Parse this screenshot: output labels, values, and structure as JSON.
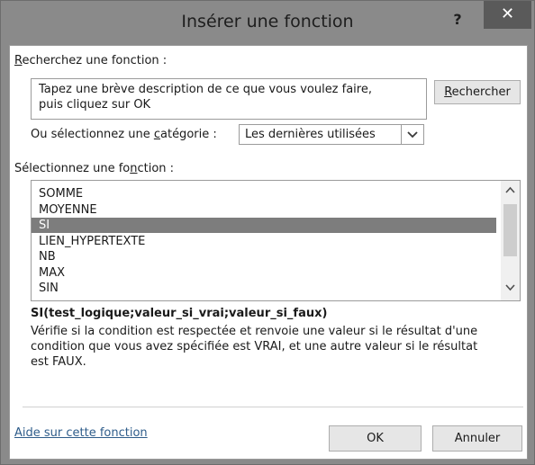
{
  "window": {
    "title": "Insérer une fonction",
    "help_glyph": "?",
    "close_glyph": "✕"
  },
  "search": {
    "label_prefix": "R",
    "label_rest": "echerchez une fonction :",
    "text_line1": "Tapez une brève description de ce que vous voulez faire,",
    "text_line2": "puis cliquez sur OK",
    "button_prefix": "R",
    "button_rest": "echercher"
  },
  "category": {
    "label_before": "Ou sélectionnez une ",
    "label_accel": "c",
    "label_after": "atégorie :",
    "selected": "Les dernières utilisées"
  },
  "function_list": {
    "label_before": "Sélectionnez une fo",
    "label_accel": "n",
    "label_after": "ction :",
    "items": [
      "SOMME",
      "MOYENNE",
      "SI",
      "LIEN_HYPERTEXTE",
      "NB",
      "MAX",
      "SIN"
    ],
    "selected_index": 2
  },
  "details": {
    "syntax": "SI(test_logique;valeur_si_vrai;valeur_si_faux)",
    "description_line1": "Vérifie si la condition est respectée et renvoie une valeur si le résultat d'une",
    "description_line2": "condition que vous avez spécifiée est VRAI, et une autre valeur si le résultat",
    "description_line3": "est FAUX."
  },
  "footer": {
    "help_link": "Aide sur cette fonction",
    "ok_label": "OK",
    "cancel_label": "Annuler"
  },
  "icons": {
    "dropdown": "chevron-down-icon",
    "scroll_up": "scroll-up-arrow-icon",
    "scroll_down": "scroll-down-arrow-icon"
  },
  "colors": {
    "titlebar": "#8a8a8a",
    "close_button": "#5a5a5a",
    "selection": "#7d7d7d",
    "link": "#2e5c8a"
  }
}
